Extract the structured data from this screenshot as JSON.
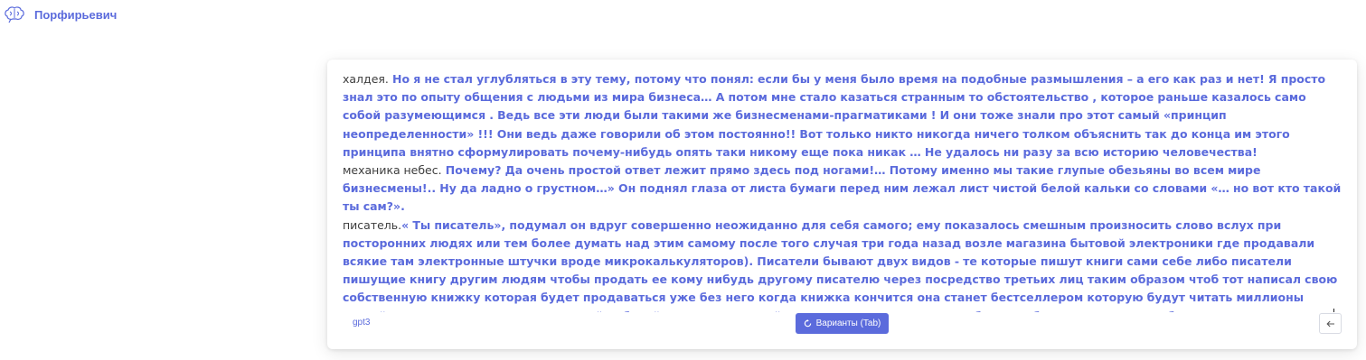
{
  "app": {
    "brand_name": "Порфирьевич",
    "logo_icon": "brain-icon",
    "accent_color": "#5b6bdc"
  },
  "editor": {
    "paragraphs": [
      {
        "prompt": "халдея.",
        "generated": " Но я не стал углубляться в эту тему, потому что понял: если бы у меня было время на подобные размышления – а его как раз и нет! Я просто знал это по опыту общения с людьми из мира бизнеса… А потом мне стало казаться странным то обстоятельство , которое раньше казалось само собой разумеющимся . Ведь все эти люди были такими же бизнесменами-прагматиками ! И они тоже знали про этот самый «принцип неопределенности» !!! Они ведь даже говорили об этом постоянно!! Вот только никто никогда ничего толком объяснить так до конца им этого принципа внятно сформулировать почему-нибудь опять таки никому еще пока никак … Не удалось ни разу за всю историю человечества!"
      },
      {
        "prompt": "механика небес.",
        "generated": " Почему? Да очень простой ответ лежит прямо здесь под ногами!… Потому именно мы такие глупые обезьяны во всем мире бизнесмены!.. Ну да ладно о грустном…» Он поднял глаза от листа бумаги перед ним лежал лист чистой белой кальки со словами «… но вот кто такой ты сам?»."
      },
      {
        "prompt": "писатель.",
        "generated": "« Ты писатель», подумал он вдруг совершенно неожиданно для себя самого; ему показалось смешным произносить слово вслух при посторонних людях или тем более думать над этим самому после того случая три года назад возле магазина бытовой электроники где продавали всякие там электронные штучки вроде микрокалькуляторов). Писатели бывают двух видов - те которые пишут книги сами себе либо писатели пишущие книгу другим людям чтобы продать ее кому нибудь другому писателю через посредство третьих лиц таким образом чтоб тот написал свою собственную книжку которая будет продаваться уже без него когда книжка кончится она станет бестселлером которую будут читать миллионы людей тогда можно считать сделанной работой писателя которой надо гордиться хотя иногда бывает обидно оттого ,что тебя используют втемную ."
      }
    ]
  },
  "footer": {
    "model_label": "gpt3",
    "variants_label": "Варианты (Tab)",
    "variants_icon": "refresh-icon",
    "back_icon": "arrow-left-icon"
  }
}
